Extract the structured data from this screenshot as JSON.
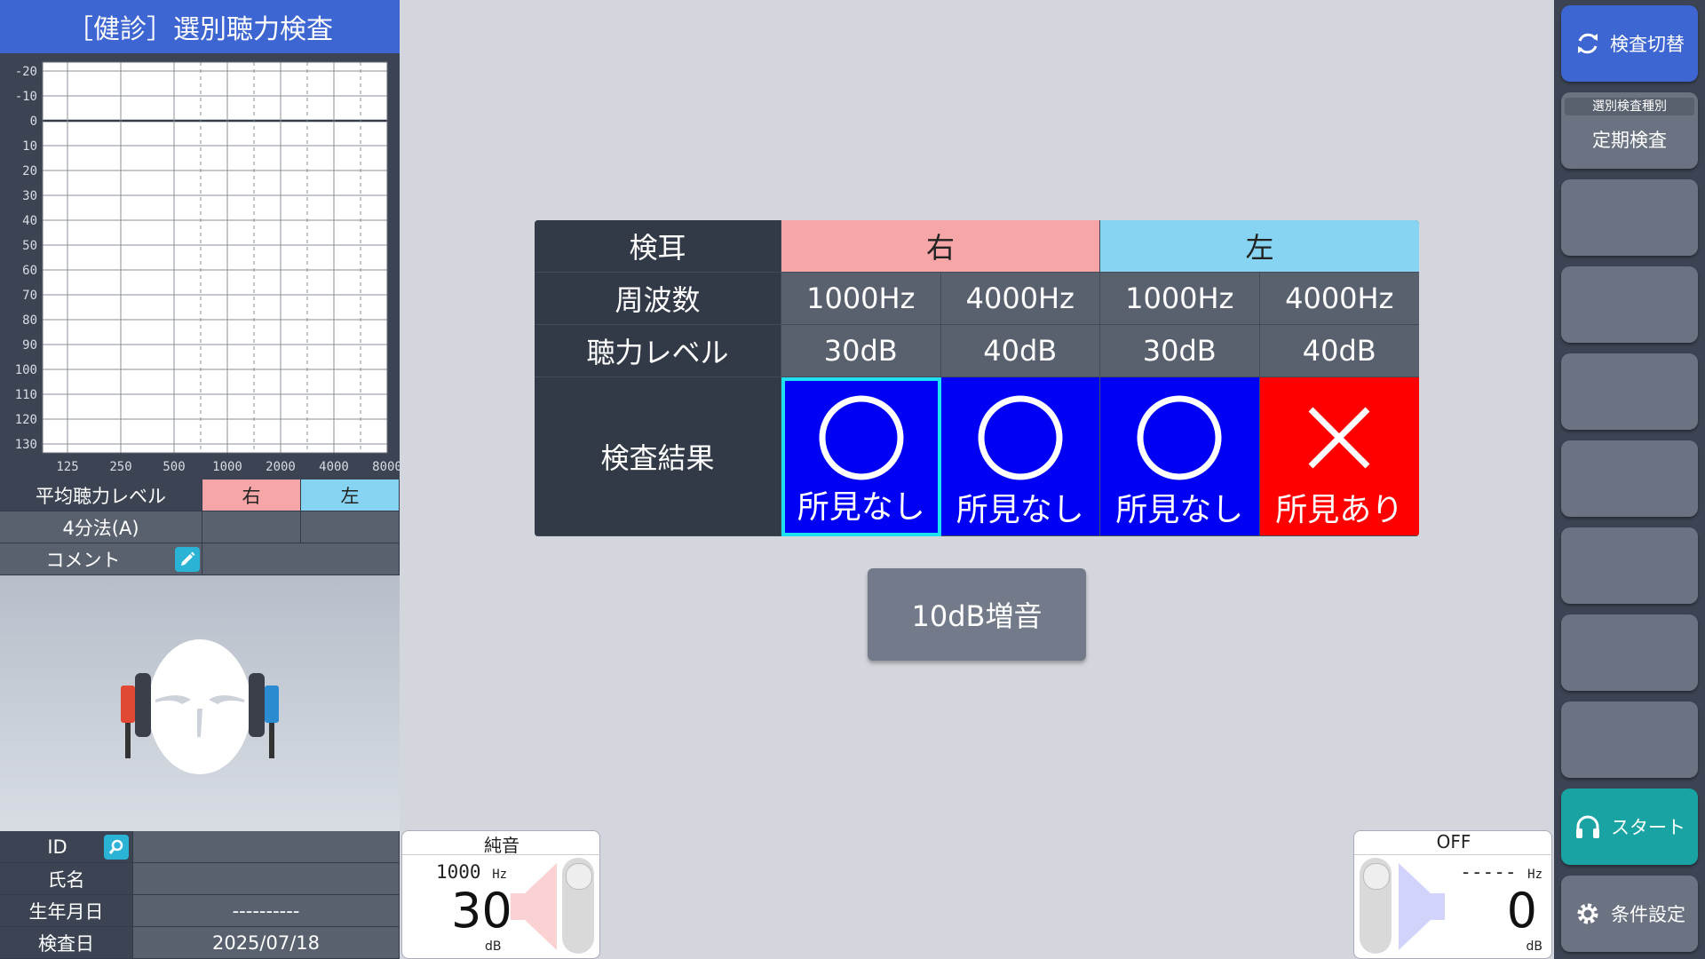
{
  "title": "［健診］選別聴力検査",
  "chart_data": {
    "type": "line",
    "y_ticks": [
      "-20",
      "-10",
      "0",
      "10",
      "20",
      "30",
      "40",
      "50",
      "60",
      "70",
      "80",
      "90",
      "100",
      "110",
      "120",
      "130"
    ],
    "x_ticks": [
      "125",
      "250",
      "500",
      "1000",
      "2000",
      "4000",
      "8000"
    ],
    "ylim": [
      -20,
      130
    ],
    "series": []
  },
  "avg": {
    "label": "平均聴力レベル",
    "right": "右",
    "left": "左",
    "method": "4分法(A)",
    "comment": "コメント"
  },
  "patient": {
    "id_label": "ID",
    "name_label": "氏名",
    "dob_label": "生年月日",
    "dob_value": "----------",
    "date_label": "検査日",
    "date_value": "2025/07/18"
  },
  "table": {
    "ear_label": "検耳",
    "right": "右",
    "left": "左",
    "freq_label": "周波数",
    "level_label": "聴力レベル",
    "result_label": "検査結果",
    "columns": [
      {
        "freq": "1000Hz",
        "level": "30dB",
        "symbol": "○",
        "result": "所見なし"
      },
      {
        "freq": "4000Hz",
        "level": "40dB",
        "symbol": "○",
        "result": "所見なし"
      },
      {
        "freq": "1000Hz",
        "level": "30dB",
        "symbol": "○",
        "result": "所見なし"
      },
      {
        "freq": "4000Hz",
        "level": "40dB",
        "symbol": "×",
        "result": "所見あり"
      }
    ]
  },
  "increase_button": "10dB増音",
  "left_output": {
    "type": "純音",
    "freq": "1000",
    "freq_unit": "Hz",
    "level": "30",
    "level_unit": "dB"
  },
  "right_output": {
    "type": "OFF",
    "freq": "-----",
    "freq_unit": "Hz",
    "level": "0",
    "level_unit": "dB"
  },
  "side": {
    "switch": "検査切替",
    "kind_label": "選別検査種別",
    "kind_value": "定期検査",
    "start": "スタート",
    "settings": "条件設定"
  },
  "colors": {
    "right_ear": "#f7a6a8",
    "left_ear": "#86d4f1",
    "normal": "#0000f5",
    "abnormal": "#ff0000",
    "start": "#19a3a3",
    "switch": "#3d66d2"
  }
}
